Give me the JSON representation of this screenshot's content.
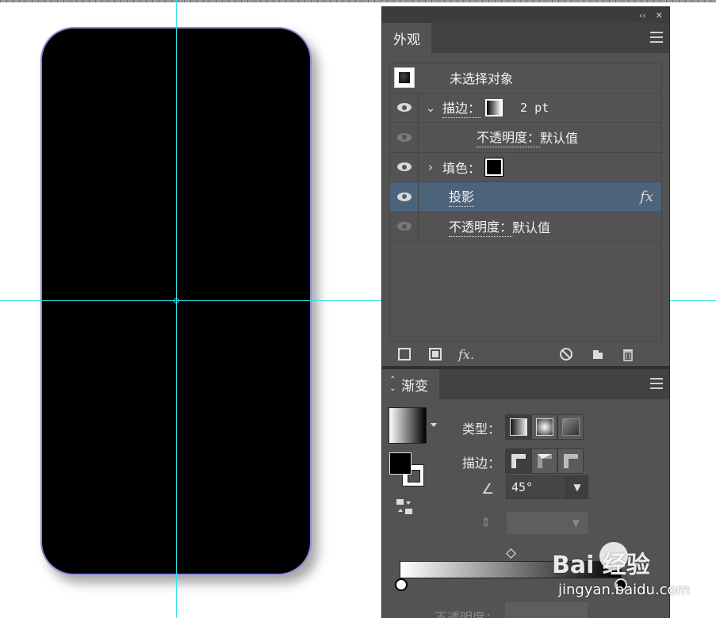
{
  "canvas": {
    "artboard_color": "#000000",
    "guide_color": "#31e3ea"
  },
  "appearance_panel": {
    "tab_label": "外观",
    "collapse_glyph": "‹‹",
    "close_glyph": "✕",
    "header_label": "未选择对象",
    "rows": [
      {
        "label": "描边：",
        "value": "2 pt",
        "expand": "⌄"
      },
      {
        "label": "不透明度：",
        "value": "默认值"
      },
      {
        "label": "填色：",
        "expand": "›"
      },
      {
        "label": "投影",
        "fx": "fx"
      },
      {
        "label": "不透明度：",
        "value": "默认值"
      }
    ],
    "toolbar": [
      "new-stroke-icon",
      "new-fill-icon",
      "fx-icon",
      "clear-icon",
      "duplicate-icon",
      "trash-icon"
    ]
  },
  "gradient_panel": {
    "tab_label": "渐变",
    "tab_arrows": "⌃⌄",
    "type_label": "类型：",
    "stroke_label": "描边：",
    "angle_value": "45°",
    "opacity_label": "不透明度："
  },
  "watermark": {
    "logo_text": "Bai  经验",
    "url": "jingyan.baidu.com"
  }
}
